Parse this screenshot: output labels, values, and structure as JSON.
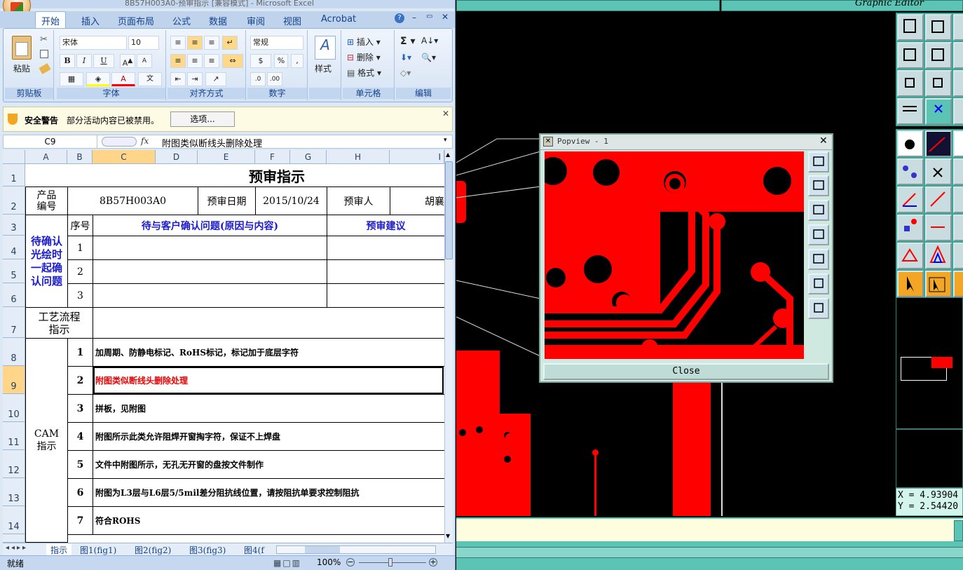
{
  "excel": {
    "window_title": "8B57H003A0-预审指示 [兼容模式] - Microsoft Excel",
    "tabs": [
      "开始",
      "插入",
      "页面布局",
      "公式",
      "数据",
      "审阅",
      "视图",
      "Acrobat"
    ],
    "ribbon": {
      "paste": "粘贴",
      "groups": [
        "剪贴板",
        "字体",
        "对齐方式",
        "数字",
        "样式",
        "单元格",
        "编辑"
      ],
      "font_name": "宋体",
      "font_size": "10",
      "number_format": "常规",
      "style_label": "样式",
      "insert": "插入",
      "delete": "删除",
      "format": "格式",
      "bold": "B",
      "italic": "I",
      "underline": "U",
      "percent": "%",
      "comma": ","
    },
    "security": {
      "title": "安全警告",
      "message": "部分活动内容已被禁用。",
      "options_button": "选项..."
    },
    "name_box": "C9",
    "fx": "fx",
    "formula": "附图类似断线头删除处理",
    "columns": [
      "A",
      "B",
      "C",
      "D",
      "E",
      "F",
      "G",
      "H",
      "I"
    ],
    "rows": [
      "1",
      "2",
      "3",
      "4",
      "5",
      "6",
      "7",
      "8",
      "9",
      "10",
      "11",
      "12",
      "13",
      "14"
    ],
    "cells": {
      "title": "预审指示",
      "product_no_label": "产品编号",
      "product_no": "8B57H003A0",
      "review_date_label": "预审日期",
      "review_date": "2015/10/24",
      "reviewer_label": "预审人",
      "reviewer": "胡襄",
      "seq_label": "序号",
      "issue_header": "待与客户确认问题(原因与内容)",
      "suggest_header": "预审建议",
      "pending_label": "待确认光绘时一起确认问题",
      "process_label": "工艺流程指示",
      "cam_label": "CAM指示",
      "seq": [
        "1",
        "2",
        "3"
      ],
      "cam_items": [
        {
          "n": "1",
          "text": "加周期、防静电标记、RoHS标记，标记加于底层字符",
          "red": false
        },
        {
          "n": "2",
          "text": "附图类似断线头删除处理",
          "red": true
        },
        {
          "n": "3",
          "text": "拼板，见附图",
          "red": false
        },
        {
          "n": "4",
          "text": "附图所示此类允许阻焊开窗掏字符，保证不上焊盘",
          "red": false
        },
        {
          "n": "5",
          "text": "文件中附图所示，无孔无开窗的盘按文件制作",
          "red": false
        },
        {
          "n": "6",
          "text": "附图为L3层与L6层5/5mil差分阻抗线位置，请按阻抗单要求控制阻抗",
          "red": false
        },
        {
          "n": "7",
          "text": "符合ROHS",
          "red": false
        }
      ]
    },
    "sheet_tabs": [
      "指示",
      "图1(fig1)",
      "图2(fig2)",
      "图3(fig3)",
      "图4(f"
    ],
    "status": "就绪",
    "zoom": "100%"
  },
  "cam": {
    "graphic_editor_title": "Graphic Editor",
    "popview_title": "Popview - 1",
    "close_button": "Close",
    "coord_x": "X = 4.93904",
    "coord_y": "Y = 2.54420",
    "colors": {
      "trace": "#ff0000",
      "bg": "#000000",
      "panel": "#34a79b",
      "popview": "#cfe8e0"
    }
  }
}
